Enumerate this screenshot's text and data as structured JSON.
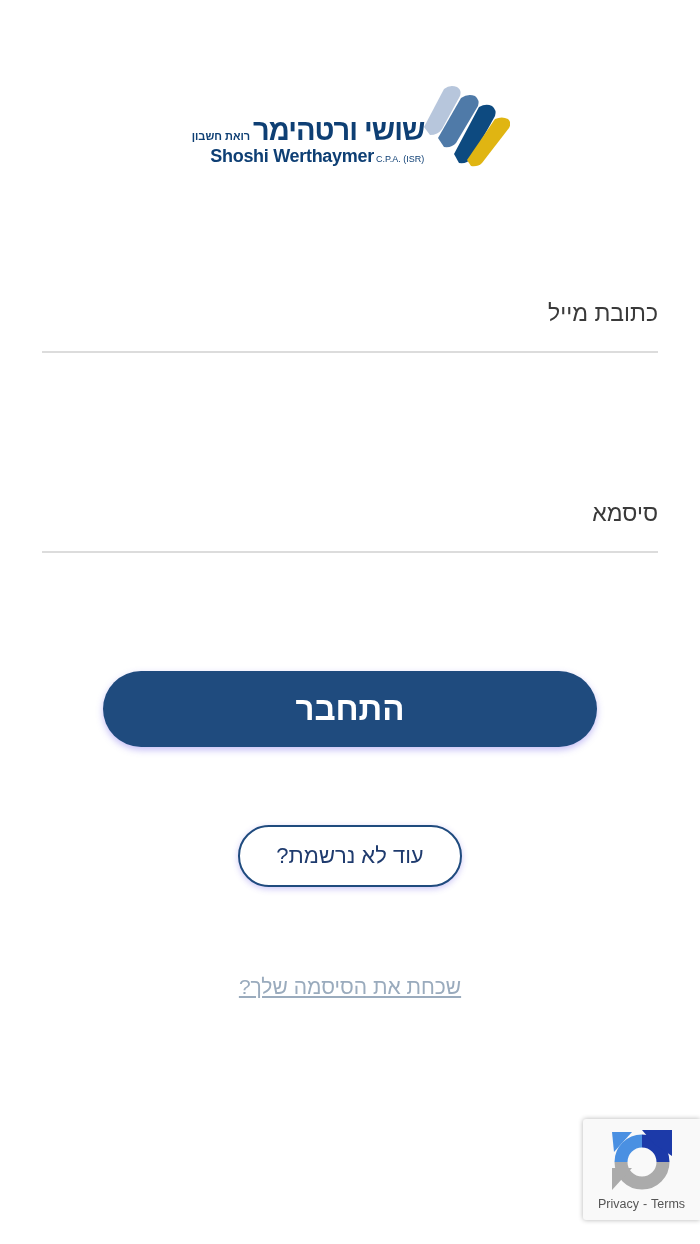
{
  "logo": {
    "hebrew_name": "שושי ורטהימר",
    "hebrew_title": "רואת חשבון",
    "english_name": "Shoshi Werthaymer",
    "english_suffix": "C.P.A. (ISR)"
  },
  "email_field": {
    "placeholder": "כתובת מייל"
  },
  "password_field": {
    "placeholder": "סיסמא"
  },
  "login_button": "התחבר",
  "register_button": "עוד לא נרשמת?",
  "forgot_link": "שכחת את הסיסמה שלך?",
  "recaptcha": {
    "privacy": "Privacy",
    "separator": "-",
    "terms": "Terms"
  }
}
